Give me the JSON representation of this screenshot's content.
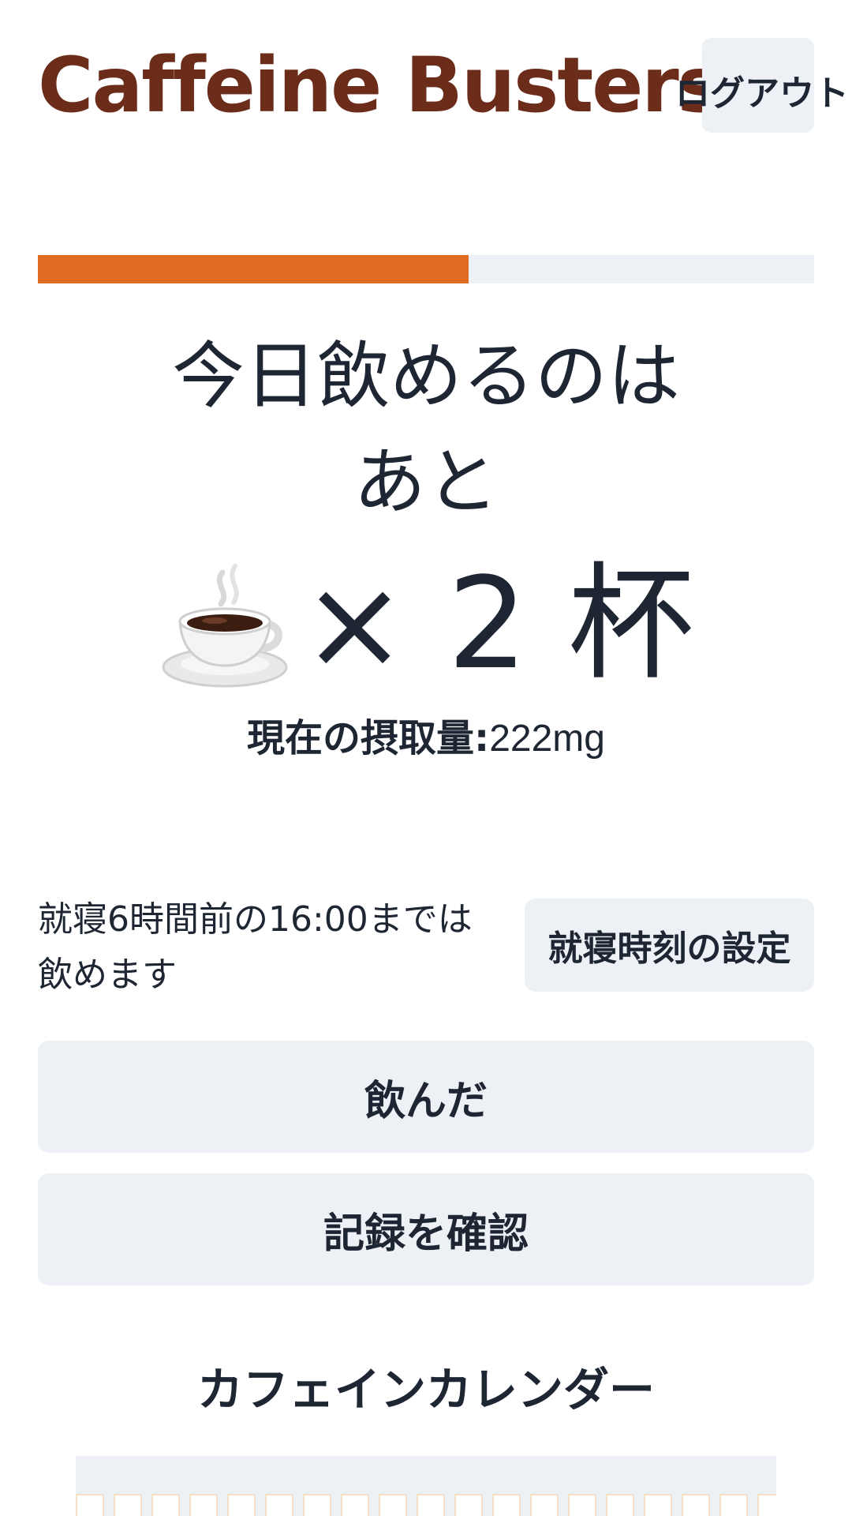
{
  "header": {
    "title": "Caffeine Busters",
    "logout_label": "ログアウト"
  },
  "progress": {
    "fraction": 0.555,
    "fill_color": "#e06c22",
    "track_color": "#edf1f5"
  },
  "remaining": {
    "line1": "今日飲めるのは",
    "line2": "あと",
    "cup_icon": "coffee-cup-icon",
    "count_text": "× 2 杯"
  },
  "intake": {
    "label": "現在の摂取量:",
    "value": "222mg"
  },
  "bedtime": {
    "note_line1": "就寝6時間前の16:00までは",
    "note_line2": "飲めます",
    "settings_label": "就寝時刻の設定"
  },
  "actions": {
    "drank_label": "飲んだ",
    "history_label": "記録を確認"
  },
  "calendar": {
    "title": "カフェインカレンダー"
  },
  "colors": {
    "brand": "#6b2c1a",
    "accent": "#e06c22",
    "button_bg": "#edf1f5",
    "text": "#1e2633"
  }
}
